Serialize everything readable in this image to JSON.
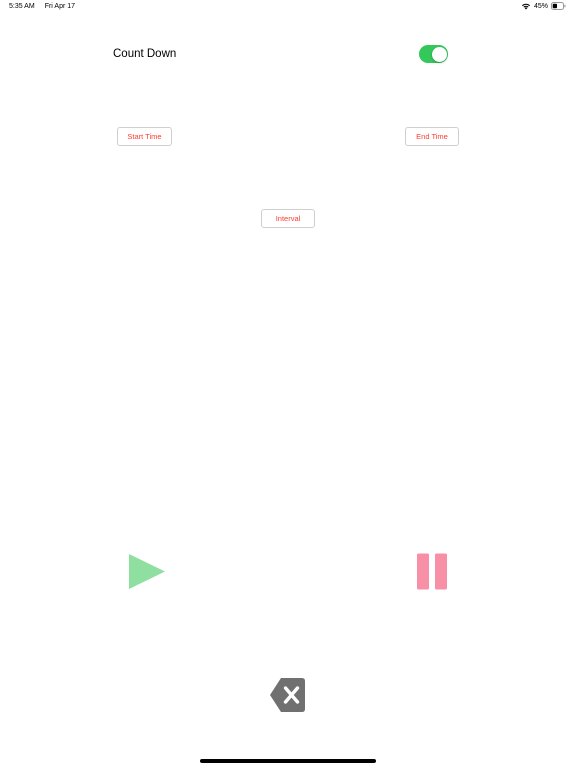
{
  "status_bar": {
    "time": "5:35 AM",
    "date": "Fri Apr 17",
    "battery_percent": "45%",
    "battery_level": 0.45,
    "wifi_icon": "wifi-icon",
    "battery_icon": "battery-icon"
  },
  "countdown": {
    "label": "Count Down",
    "toggle_on": true,
    "toggle_color": "#34c759"
  },
  "buttons": {
    "start_time": "Start Time",
    "end_time": "End Time",
    "interval": "Interval",
    "text_color": "#ff3b30"
  },
  "controls": {
    "play_icon": "play-icon",
    "play_color": "#8fdfa0",
    "pause_icon": "pause-icon",
    "pause_color": "#f78fa6",
    "delete_icon": "delete-icon",
    "delete_color": "#707070"
  }
}
